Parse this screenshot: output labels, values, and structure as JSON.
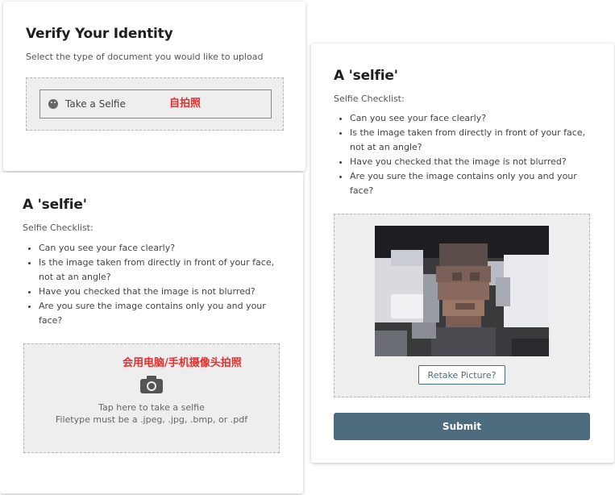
{
  "verify": {
    "title": "Verify Your Identity",
    "subtitle": "Select the type of document you would like to upload",
    "selfie_option": "Take a Selfie",
    "selfie_option_icon": "smile-icon",
    "annotation": "自拍照"
  },
  "selfie_left": {
    "title": "A 'selfie'",
    "checklist_label": "Selfie Checklist:",
    "checklist": [
      "Can you see your face clearly?",
      "Is the image taken from directly in front of your face, not at an angle?",
      "Have you checked that the image is not blurred?",
      "Are you sure the image contains only you and your face?"
    ],
    "annotation": "会用电脑/手机摄像头拍照",
    "upload_icon": "camera-icon",
    "upload_line1": "Tap here to take a selfie",
    "upload_line2": "Filetype must be a .jpeg, .jpg, .bmp, or .pdf"
  },
  "selfie_right": {
    "title": "A 'selfie'",
    "checklist_label": "Selfie Checklist:",
    "checklist": [
      "Can you see your face clearly?",
      "Is the image taken from directly in front of your face, not at an angle?",
      "Have you checked that the image is not blurred?",
      "Are you sure the image contains only you and your face?"
    ],
    "retake_label": "Retake Picture?",
    "submit_label": "Submit"
  },
  "colors": {
    "accent": "#4c6b7d",
    "annotation": "#e03030",
    "dropzone_bg": "#eeeeee"
  }
}
